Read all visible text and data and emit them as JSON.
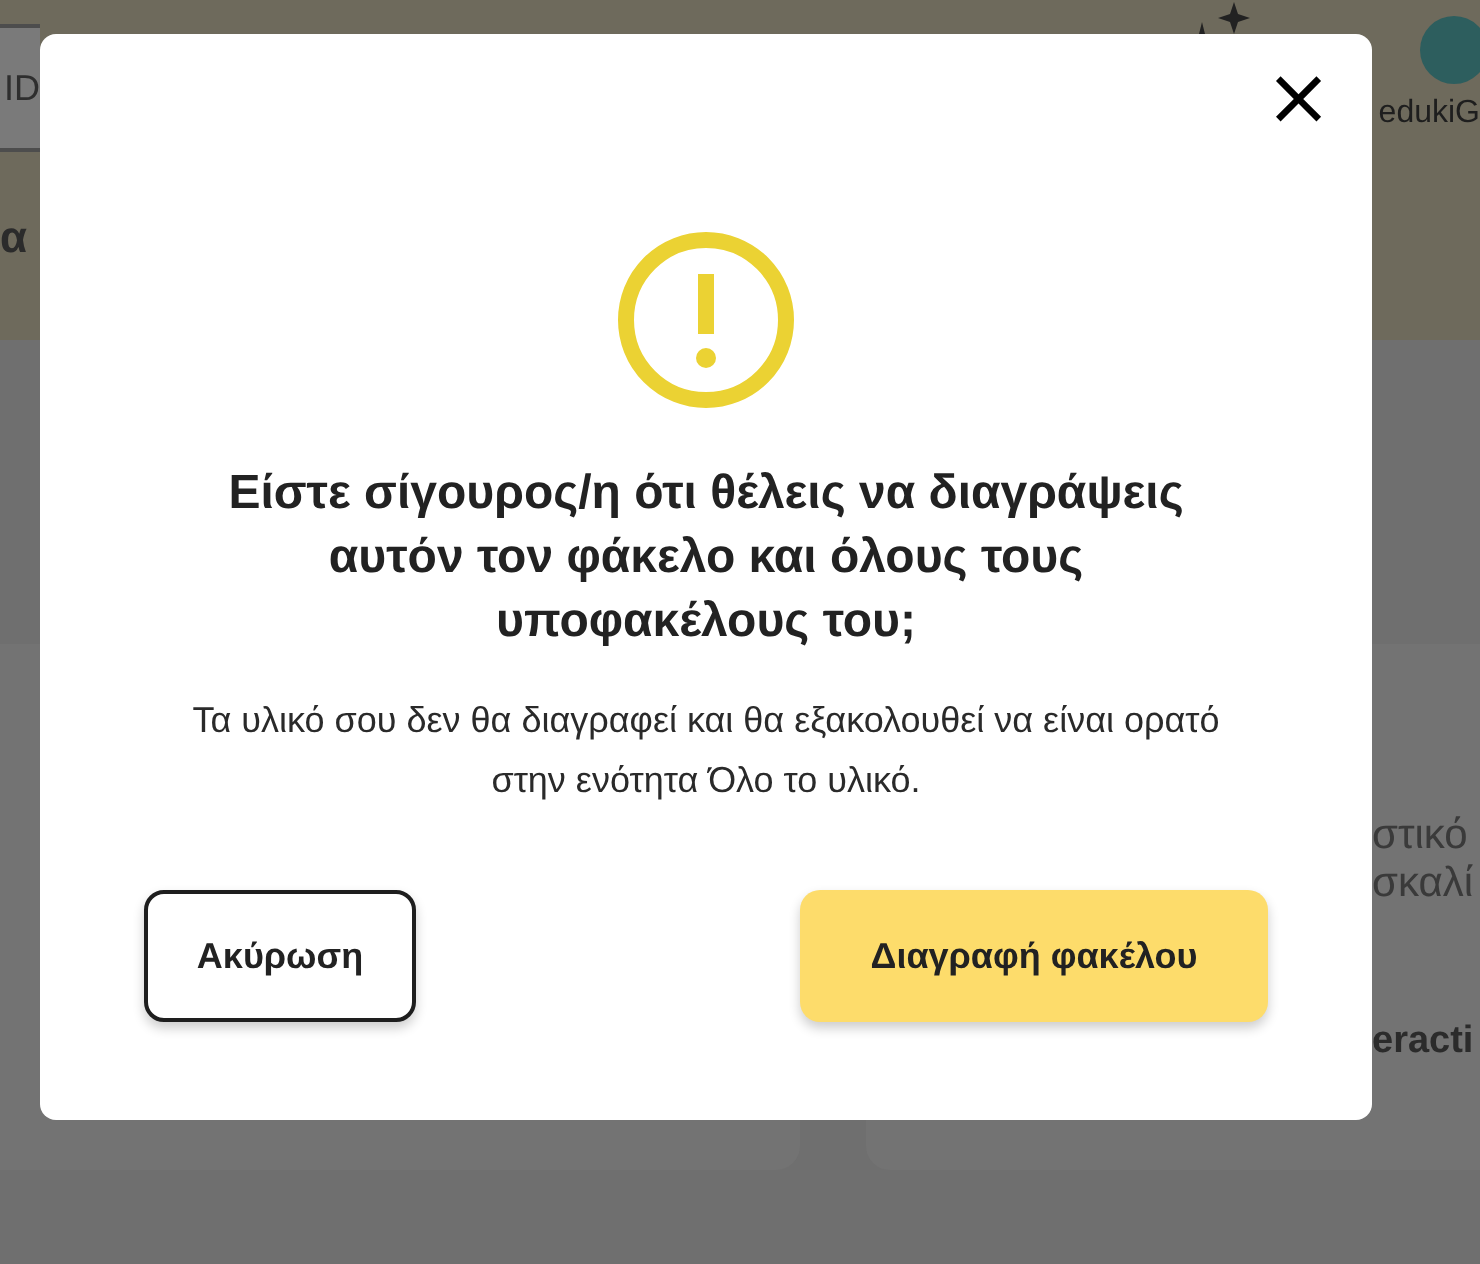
{
  "background": {
    "search": {
      "value": "ID"
    },
    "user_name": "edukiG",
    "heading_fragment": "α",
    "card_lines": [
      "στικό",
      "σκαλί"
    ],
    "card_bold": "eracti"
  },
  "dialog": {
    "close": "×",
    "title": "Είστε σίγουρος/η ότι θέλεις να διαγράψεις αυτόν τον φάκελο και όλους τους υποφακέλους του;",
    "message": "Τα υλικό σου δεν θα διαγραφεί και θα εξακολουθεί να είναι ορατό στην ενότητα Όλο το υλικό.",
    "buttons": [
      {
        "label": "Ακύρωση",
        "kind": "secondary"
      },
      {
        "label": "Διαγραφή φακέλου",
        "kind": "primary"
      }
    ]
  }
}
